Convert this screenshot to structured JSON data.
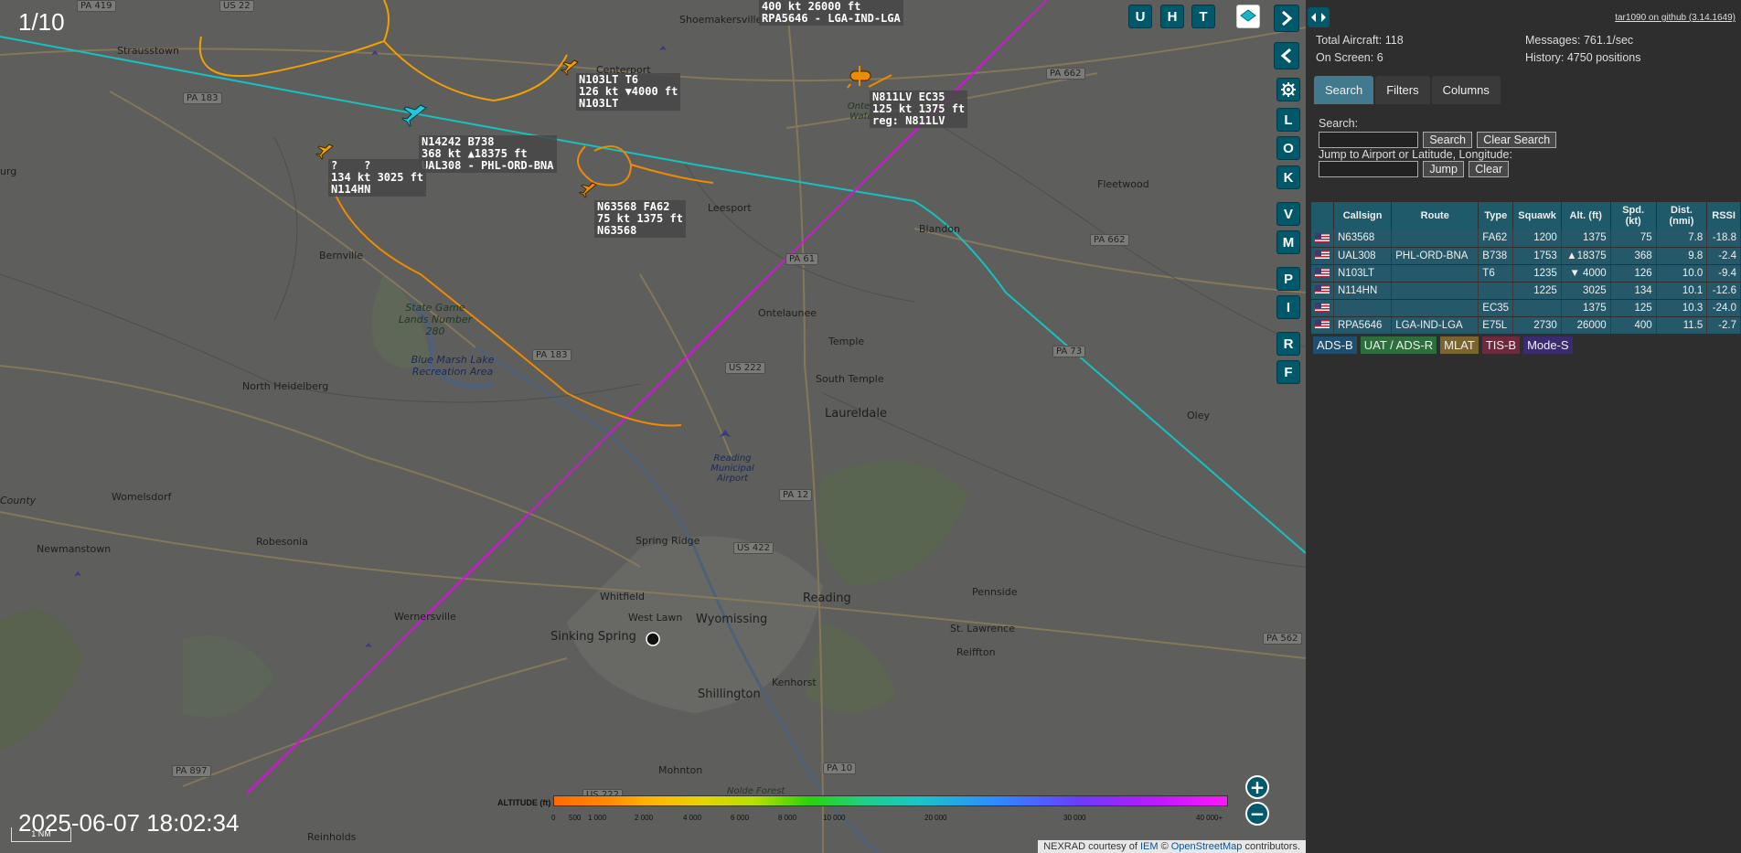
{
  "map": {
    "page_counter": "1/10",
    "clock": "2025-06-07 18:02:34",
    "scale_bar": "1 NM",
    "attribution": {
      "nexrad": "NEXRAD courtesy of",
      "iem": "IEM",
      "copy": "©",
      "osm": "OpenStreetMap",
      "contrib": "contributors."
    },
    "places": [
      "Strausstown",
      "Centerport",
      "Shoemakersville",
      "Bernville",
      "Leesport",
      "Ontelaunee",
      "Temple",
      "South Temple",
      "Laureldale",
      "Blandon",
      "Fleetwood",
      "Oley",
      "North Heidelberg",
      "Womelsdorf",
      "Newmanstown",
      "Robesonia",
      "Wernersville",
      "Sinking Spring",
      "Spring Ridge",
      "Whitfield",
      "West Lawn",
      "Wyomissing",
      "Reading",
      "Shillington",
      "Kenhorst",
      "Mohnton",
      "Pennside",
      "St. Lawrence",
      "Reiffton",
      "Reinholds",
      "State Game Lands Number 280",
      "Blue Marsh Lake Recreation Area",
      "Reading Municipal Airport",
      "Ontelaunee Watershed",
      "Nolde Forest",
      "urg",
      "County"
    ],
    "roads": [
      "US 22",
      "PA 183",
      "PA 662",
      "PA 61",
      "PA 183",
      "US 222",
      "PA 73",
      "PA 12",
      "US 422",
      "PA 662",
      "PA 897",
      "PA 10",
      "US 222",
      "PA 562",
      "PA 419"
    ],
    "aircraft_labels": [
      {
        "id": "N103LT",
        "text": "N103LT T6\n126 kt ▼4000 ft\nN103LT"
      },
      {
        "id": "N14242",
        "text": "N14242 B738\n368 kt ▲18375 ft\nUAL308 - PHL-ORD-BNA"
      },
      {
        "id": "N114HN",
        "text": "?    ?\n134 kt 3025 ft\nN114HN"
      },
      {
        "id": "N63568",
        "text": "N63568 FA62\n75 kt 1375 ft\nN63568"
      },
      {
        "id": "N811LV",
        "text": "N811LV EC35\n125 kt 1375 ft\nreg: N811LV"
      },
      {
        "id": "RPA5646",
        "text": "400 kt 26000 ft\nRPA5646 - LGA-IND-LGA"
      }
    ],
    "buttons": {
      "top": [
        "U",
        "H",
        "T"
      ],
      "side": [
        "L",
        "O",
        "K",
        "V",
        "M",
        "P",
        "I",
        "R",
        "F"
      ],
      "zoom_in": "+",
      "zoom_out": "−"
    },
    "altitude_legend": {
      "label": "ALTITUDE (ft)",
      "ticks": [
        "0",
        "500",
        "1 000",
        "2 000",
        "4 000",
        "6 000",
        "8 000",
        "10 000",
        "20 000",
        "30 000",
        "40 000+"
      ]
    }
  },
  "sidebar": {
    "version_link": "tar1090 on github (3.14.1649)",
    "stats": {
      "total_aircraft_label": "Total Aircraft:",
      "total_aircraft": "118",
      "on_screen_label": "On Screen:",
      "on_screen": "6",
      "messages_label": "Messages:",
      "messages": "761.1/sec",
      "history_label": "History:",
      "history": "4750 positions"
    },
    "tabs": [
      "Search",
      "Filters",
      "Columns"
    ],
    "search": {
      "label": "Search:",
      "search_btn": "Search",
      "clear_btn": "Clear Search",
      "jump_label": "Jump to Airport or Latitude, Longitude:",
      "jump_btn": "Jump",
      "jump_clear_btn": "Clear"
    },
    "table": {
      "columns": [
        "Callsign",
        "Route",
        "Type",
        "Squawk",
        "Alt. (ft)",
        "Spd. (kt)",
        "Dist. (nmi)",
        "RSSI"
      ],
      "rows": [
        [
          "N63568",
          "",
          "FA62",
          "1200",
          "1375",
          "75",
          "7.8",
          "-18.8"
        ],
        [
          "UAL308",
          "PHL-ORD-BNA",
          "B738",
          "1753",
          "▲18375",
          "368",
          "9.8",
          "-2.4"
        ],
        [
          "N103LT",
          "",
          "T6",
          "1235",
          "▼ 4000",
          "126",
          "10.0",
          "-9.4"
        ],
        [
          "N114HN",
          "",
          "",
          "1225",
          "3025",
          "134",
          "10.1",
          "-12.6"
        ],
        [
          "",
          "",
          "EC35",
          "",
          "1375",
          "125",
          "10.3",
          "-24.0"
        ],
        [
          "RPA5646",
          "LGA-IND-LGA",
          "E75L",
          "2730",
          "26000",
          "400",
          "11.5",
          "-2.7"
        ]
      ]
    },
    "source_badges": [
      {
        "label": "ADS-B",
        "color": "#1f4e6e"
      },
      {
        "label": "UAT / ADS-R",
        "color": "#2e6e3c"
      },
      {
        "label": "MLAT",
        "color": "#7a6430"
      },
      {
        "label": "TIS-B",
        "color": "#6e2a3c"
      },
      {
        "label": "Mode-S",
        "color": "#3c2a6e"
      }
    ]
  }
}
